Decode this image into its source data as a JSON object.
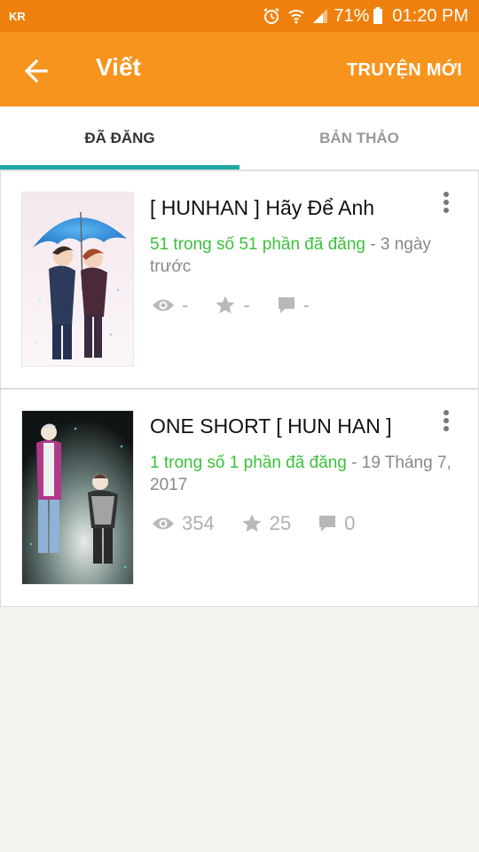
{
  "status_bar": {
    "carrier": "KR",
    "battery": "71%",
    "time": "01:20 PM"
  },
  "app_bar": {
    "title": "Viết",
    "new_story_label": "TRUYỆN MỚI"
  },
  "tabs": [
    {
      "label": "ĐÃ ĐĂNG",
      "active": true
    },
    {
      "label": "BẢN THẢO",
      "active": false
    }
  ],
  "stories": [
    {
      "title": "[  HUNHAN ] Hãy Để Anh",
      "parts": "51 trong số 51 phần đã đăng",
      "separator": " - ",
      "date": "3 ngày trước",
      "reads": "-",
      "votes": "-",
      "comments": "-"
    },
    {
      "title": "ONE SHORT [ HUN HAN ]",
      "parts": "1 trong số 1 phần đã đăng",
      "separator": " - ",
      "date": "19 Tháng 7, 2017",
      "reads": "354",
      "votes": "25",
      "comments": "0"
    }
  ],
  "colors": {
    "status_bar": "#f0800d",
    "app_bar": "#f7941d",
    "tab_indicator": "#1fa8a6",
    "parts_text": "#3cc23c"
  }
}
